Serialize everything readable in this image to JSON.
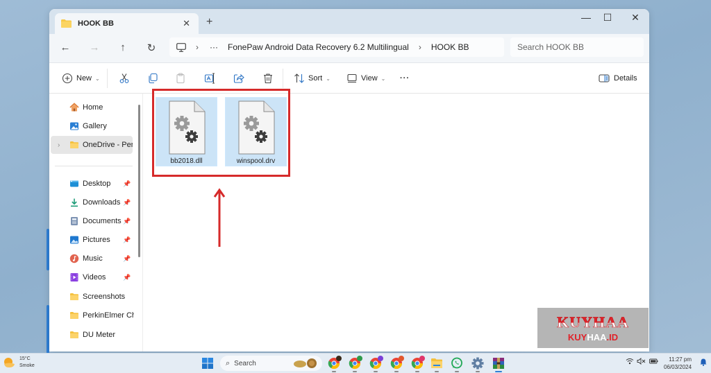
{
  "window": {
    "tab_title": "HOOK BB",
    "new_tab_symbol": "+",
    "close_tab_symbol": "✕",
    "controls": {
      "minimize": "—",
      "maximize": "☐",
      "close": "✕"
    }
  },
  "nav": {
    "back": "←",
    "forward": "→",
    "up": "↑",
    "refresh": "↻",
    "breadcrumb": [
      "FonePaw Android Data Recovery 6.2 Multilingual",
      "HOOK BB"
    ],
    "overflow": "···",
    "search_placeholder": "Search HOOK BB"
  },
  "toolbar": {
    "new_label": "New",
    "sort_label": "Sort",
    "view_label": "View",
    "more_label": "···",
    "details_label": "Details",
    "icons": [
      "plus-circle-icon",
      "cut-icon",
      "copy-icon",
      "paste-icon",
      "rename-icon",
      "share-icon",
      "delete-icon",
      "sort-icon",
      "view-icon",
      "more-icon",
      "details-pane-icon"
    ]
  },
  "sidebar": {
    "top_items": [
      {
        "label": "Home",
        "icon": "home-icon"
      },
      {
        "label": "Gallery",
        "icon": "gallery-icon"
      },
      {
        "label": "OneDrive - Personal",
        "icon": "folder-icon",
        "selected": true
      }
    ],
    "quick_access": [
      {
        "label": "Desktop",
        "icon": "desktop-icon",
        "pinned": true
      },
      {
        "label": "Downloads",
        "icon": "download-icon",
        "pinned": true
      },
      {
        "label": "Documents",
        "icon": "documents-icon",
        "pinned": true
      },
      {
        "label": "Pictures",
        "icon": "pictures-icon",
        "pinned": true
      },
      {
        "label": "Music",
        "icon": "music-icon",
        "pinned": true
      },
      {
        "label": "Videos",
        "icon": "videos-icon",
        "pinned": true
      },
      {
        "label": "Screenshots",
        "icon": "folder-icon",
        "pinned": false
      },
      {
        "label": "PerkinElmer Chem",
        "icon": "folder-icon",
        "pinned": false
      },
      {
        "label": "DU Meter",
        "icon": "folder-icon",
        "pinned": false
      }
    ]
  },
  "files": [
    {
      "name": "bb2018.dll",
      "icon": "system-file-icon"
    },
    {
      "name": "winspool.drv",
      "icon": "system-file-icon"
    }
  ],
  "annotation": {
    "box_color": "#d62a2a",
    "arrow_color": "#d62a2a"
  },
  "watermark": {
    "big": "KUYHAA",
    "small_red": "KUY",
    "small_white": "HAA",
    "small_suffix": ".ID"
  },
  "taskbar": {
    "weather_temp": "15°C",
    "weather_desc": "Smoke",
    "search_label": "Search",
    "apps": [
      "chrome-icon",
      "chrome-icon",
      "chrome-icon",
      "chrome-icon",
      "chrome-icon",
      "file-explorer-icon",
      "whatsapp-icon",
      "settings-icon",
      "winrar-icon"
    ],
    "time": "11:27 pm",
    "date": "06/03/2024"
  },
  "colors": {
    "accent": "#2f7fd6",
    "selection": "#cce4f7",
    "folder": "#f7c948"
  }
}
